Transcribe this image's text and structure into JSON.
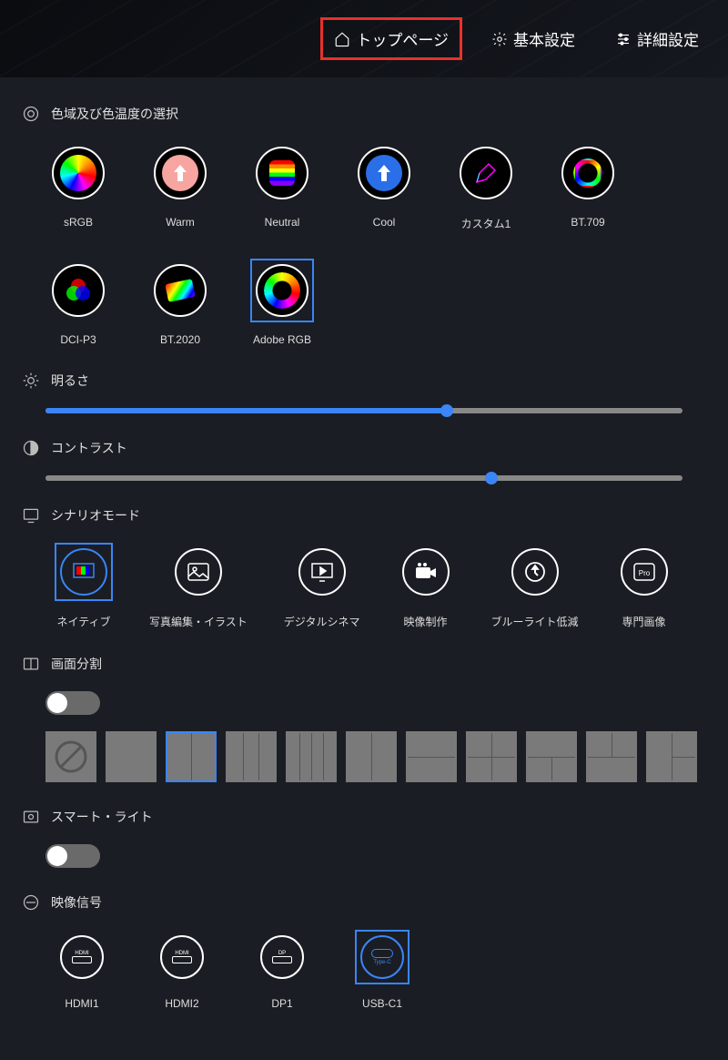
{
  "nav": {
    "top": {
      "label": "トップページ"
    },
    "basic": {
      "label": "基本設定"
    },
    "advanced": {
      "label": "詳細設定"
    }
  },
  "sections": {
    "gamut": {
      "title": "色域及び色温度の選択"
    },
    "brightness": {
      "title": "明るさ",
      "value": 63
    },
    "contrast": {
      "title": "コントラスト",
      "value": 70
    },
    "scenario": {
      "title": "シナリオモード"
    },
    "split": {
      "title": "画面分割"
    },
    "smartlight": {
      "title": "スマート・ライト"
    },
    "signal": {
      "title": "映像信号"
    }
  },
  "gamut_presets": [
    {
      "id": "srgb",
      "label": "sRGB"
    },
    {
      "id": "warm",
      "label": "Warm"
    },
    {
      "id": "neutral",
      "label": "Neutral"
    },
    {
      "id": "cool",
      "label": "Cool"
    },
    {
      "id": "custom1",
      "label": "カスタム1"
    },
    {
      "id": "bt709",
      "label": "BT.709"
    },
    {
      "id": "dcip3",
      "label": "DCI-P3"
    },
    {
      "id": "bt2020",
      "label": "BT.2020"
    },
    {
      "id": "adobergb",
      "label": "Adobe RGB",
      "selected": true
    }
  ],
  "scenarios": [
    {
      "id": "native",
      "label": "ネイティブ",
      "selected": true
    },
    {
      "id": "photo",
      "label": "写真編集・イラスト"
    },
    {
      "id": "cinema",
      "label": "デジタルシネマ"
    },
    {
      "id": "video",
      "label": "映像制作"
    },
    {
      "id": "bluelight",
      "label": "ブルーライト低減"
    },
    {
      "id": "pro",
      "label": "専門画像"
    }
  ],
  "split_layouts": [
    {
      "id": "none"
    },
    {
      "id": "full"
    },
    {
      "id": "v2",
      "selected": true
    },
    {
      "id": "v3a"
    },
    {
      "id": "v3b"
    },
    {
      "id": "v4"
    },
    {
      "id": "h2"
    },
    {
      "id": "q4"
    },
    {
      "id": "t3a"
    },
    {
      "id": "t3b"
    },
    {
      "id": "t3c"
    }
  ],
  "signals": [
    {
      "id": "hdmi1",
      "label": "HDMI1",
      "port": "HDMI"
    },
    {
      "id": "hdmi2",
      "label": "HDMI2",
      "port": "HDMI"
    },
    {
      "id": "dp1",
      "label": "DP1",
      "port": "DP"
    },
    {
      "id": "usbc1",
      "label": "USB-C1",
      "port": "Type-C",
      "selected": true
    }
  ],
  "colors": {
    "accent": "#3a85f7",
    "highlight_border": "#e8312b"
  }
}
